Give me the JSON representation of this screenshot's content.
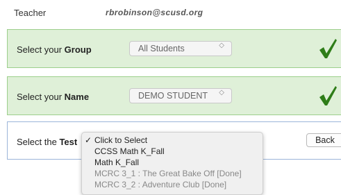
{
  "teacher": {
    "label": "Teacher",
    "value": "rbrobinson@scusd.org"
  },
  "group": {
    "label_prefix": "Select your ",
    "label_bold": "Group",
    "selected": "All Students"
  },
  "name": {
    "label_prefix": "Select your ",
    "label_bold": "Name",
    "selected": "DEMO STUDENT"
  },
  "test": {
    "label_prefix": "Select the ",
    "label_bold": "Test",
    "back_label": "Back",
    "options": [
      {
        "label": "Click to Select",
        "checked": true,
        "enabled": true
      },
      {
        "label": "CCSS Math K_Fall",
        "checked": false,
        "enabled": true
      },
      {
        "label": "Math K_Fall",
        "checked": false,
        "enabled": true
      },
      {
        "label": "MCRC 3_1 : The Great Bake Off [Done]",
        "checked": false,
        "enabled": false
      },
      {
        "label": "MCRC 3_2 : Adventure Club [Done]",
        "checked": false,
        "enabled": false
      }
    ],
    "checkmark_glyph": "✓"
  },
  "colors": {
    "panel_green_bg": "#dff0d8",
    "check_green": "#2e7d18",
    "disabled_text": "#888888"
  },
  "icons": {
    "select_arrows": "updown-arrows-icon",
    "valid": "green-checkmark-icon"
  }
}
